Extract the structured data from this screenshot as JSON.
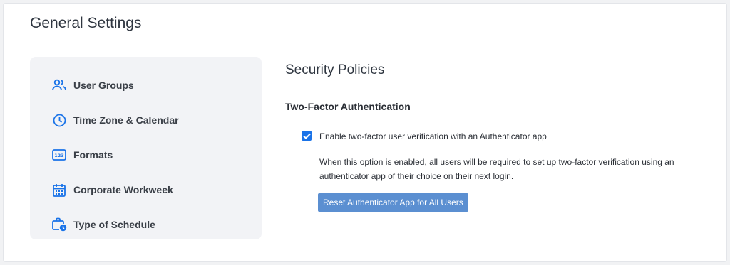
{
  "page": {
    "title": "General Settings"
  },
  "sidebar": {
    "items": [
      {
        "label": "User Groups",
        "icon": "users-icon"
      },
      {
        "label": "Time Zone & Calendar",
        "icon": "clock-icon"
      },
      {
        "label": "Formats",
        "icon": "number-format-icon"
      },
      {
        "label": "Corporate Workweek",
        "icon": "calendar-icon"
      },
      {
        "label": "Type of Schedule",
        "icon": "briefcase-clock-icon"
      }
    ]
  },
  "content": {
    "section_title": "Security Policies",
    "two_factor": {
      "title": "Two-Factor Authentication",
      "checkbox_label": "Enable two-factor user verification with an Authenticator app",
      "checked": true,
      "description": "When this option is enabled, all users will be required to set up two-factor verification using an authenticator app of their choice on their next login.",
      "reset_button": "Reset Authenticator App for All Users"
    }
  },
  "colors": {
    "accent": "#1a73e8",
    "button": "#5b8fd1",
    "sidebar_bg": "#f2f3f6"
  }
}
